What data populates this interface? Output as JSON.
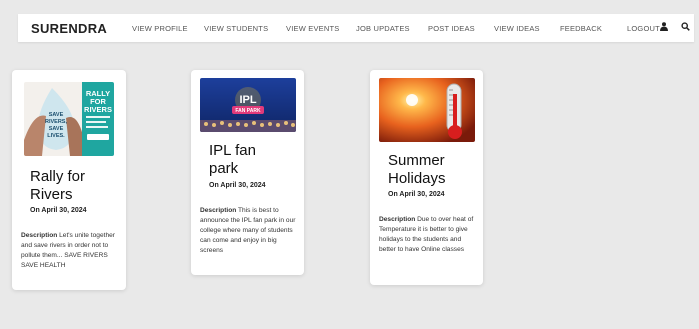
{
  "navbar": {
    "brand": "SURENDRA",
    "items": [
      {
        "label": "VIEW PROFILE"
      },
      {
        "label": "VIEW STUDENTS"
      },
      {
        "label": "VIEW EVENTS"
      },
      {
        "label": "JOB UPDATES"
      },
      {
        "label": "POST IDEAS"
      },
      {
        "label": "VIEW IDEAS"
      },
      {
        "label": "FEEDBACK"
      },
      {
        "label": "LOGOUT"
      }
    ],
    "icons": [
      "user-icon",
      "search-icon"
    ]
  },
  "cards": [
    {
      "image_text": {
        "line1": "RALLY",
        "line2": "FOR",
        "line3": "RIVERS",
        "overlay1": "SAVE",
        "overlay2": "RIVERS,",
        "overlay3": "SAVE",
        "overlay4": "LIVES."
      },
      "title": "Rally for\nRivers",
      "date": "On April 30, 2024",
      "desc_label": "Description",
      "desc_text": "Let's unite together and save rivers in order not to pollute them... SAVE RIVERS SAVE HEALTH"
    },
    {
      "image_text": {
        "line1": "IPL",
        "line2": "FAN PARK"
      },
      "title": "IPL fan\npark",
      "date": "On April 30, 2024",
      "desc_label": "Description",
      "desc_text": "This is best to announce the IPL fan park in our college where many of students can come and enjoy in big screens"
    },
    {
      "title": "Summer\nHolidays",
      "date": "On April 30, 2024",
      "desc_label": "Description",
      "desc_text": "Due to over heat of Temperature it is better to give holidays to the students and better to have Online classes"
    }
  ]
}
